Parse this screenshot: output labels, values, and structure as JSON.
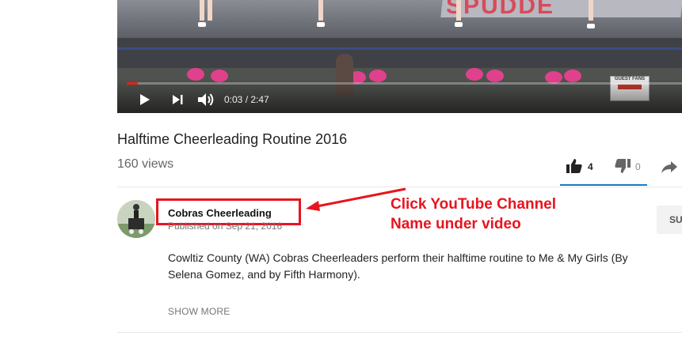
{
  "player": {
    "banner_text": "SPUDDE",
    "sign_text": "GUEST FANS",
    "time_current": "0:03",
    "time_sep": " / ",
    "time_total": "2:47",
    "progress_percent": 2,
    "icons": {
      "play": "play-icon",
      "next": "next-icon",
      "volume": "volume-icon"
    }
  },
  "video": {
    "title": "Halftime Cheerleading Routine 2016",
    "views": "160 views"
  },
  "actions": {
    "likes": "4",
    "dislikes": "0",
    "icons": {
      "like": "thumbs-up-icon",
      "dislike": "thumbs-down-icon",
      "share": "share-icon"
    }
  },
  "owner": {
    "channel_name": "Cobras Cheerleading",
    "published": "Published on Sep 21, 2016",
    "subscribe_label": "SU"
  },
  "annotation": {
    "line1": "Click YouTube Channel",
    "line2": "Name under video",
    "color": "#e8141e"
  },
  "description": {
    "text": "Cowltiz County (WA) Cobras Cheerleaders perform their halftime routine to Me & My Girls (By Selena Gomez, and by Fifth Harmony).",
    "show_more": "SHOW MORE"
  },
  "colors": {
    "progress": "#e62117",
    "like_bar": "#167ac6"
  }
}
